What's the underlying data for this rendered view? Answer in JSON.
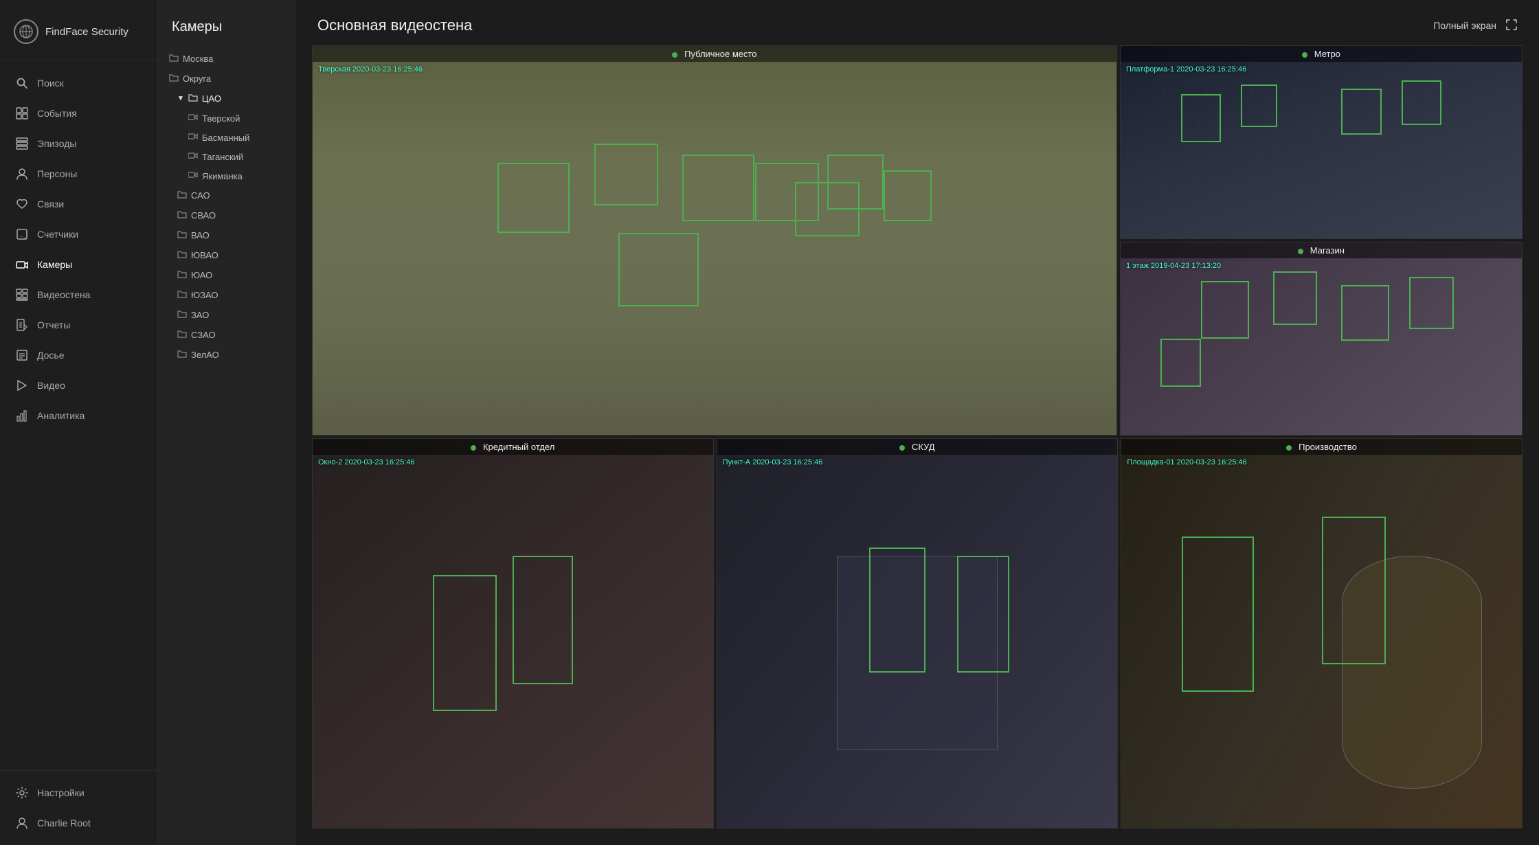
{
  "app": {
    "name": "FindFace Security"
  },
  "sidebar": {
    "items": [
      {
        "id": "search",
        "label": "Поиск",
        "icon": "🔍"
      },
      {
        "id": "events",
        "label": "События",
        "icon": "⊞"
      },
      {
        "id": "episodes",
        "label": "Эпизоды",
        "icon": "⊟"
      },
      {
        "id": "persons",
        "label": "Персоны",
        "icon": "😷"
      },
      {
        "id": "relations",
        "label": "Связи",
        "icon": "♥"
      },
      {
        "id": "counters",
        "label": "Счетчики",
        "icon": "⊡"
      },
      {
        "id": "cameras",
        "label": "Камеры",
        "icon": "📷"
      },
      {
        "id": "videowall",
        "label": "Видеостена",
        "icon": "⊞"
      },
      {
        "id": "reports",
        "label": "Отчеты",
        "icon": "📊"
      },
      {
        "id": "dossier",
        "label": "Досье",
        "icon": "⊟"
      },
      {
        "id": "video",
        "label": "Видео",
        "icon": "🎬"
      },
      {
        "id": "analytics",
        "label": "Аналитика",
        "icon": "📈"
      }
    ],
    "footer": [
      {
        "id": "settings",
        "label": "Настройки",
        "icon": "⚙"
      },
      {
        "id": "user",
        "label": "Charlie Root",
        "icon": "👤"
      }
    ]
  },
  "cameraTree": {
    "title": "Камеры",
    "items": [
      {
        "id": "moskva",
        "level": 1,
        "icon": "folder",
        "label": "Москва"
      },
      {
        "id": "okruga",
        "level": 1,
        "icon": "folder",
        "label": "Округа"
      },
      {
        "id": "cao",
        "level": 2,
        "icon": "folder-open",
        "label": "ЦАО",
        "expanded": true
      },
      {
        "id": "tverskoy",
        "level": 3,
        "icon": "camera",
        "label": "Тверской"
      },
      {
        "id": "basmanny",
        "level": 3,
        "icon": "camera",
        "label": "Басманный"
      },
      {
        "id": "tagansky",
        "level": 3,
        "icon": "camera",
        "label": "Таганский"
      },
      {
        "id": "yakimanka",
        "level": 3,
        "icon": "camera",
        "label": "Якиманка"
      },
      {
        "id": "sao",
        "level": 2,
        "icon": "folder",
        "label": "САО"
      },
      {
        "id": "svao",
        "level": 2,
        "icon": "folder",
        "label": "СВАО"
      },
      {
        "id": "vao",
        "level": 2,
        "icon": "folder",
        "label": "ВАО"
      },
      {
        "id": "uvao",
        "level": 2,
        "icon": "folder",
        "label": "ЮВАО"
      },
      {
        "id": "uao",
        "level": 2,
        "icon": "folder",
        "label": "ЮАО"
      },
      {
        "id": "uzao",
        "level": 2,
        "icon": "folder",
        "label": "ЮЗАО"
      },
      {
        "id": "zao",
        "level": 2,
        "icon": "folder",
        "label": "ЗАО"
      },
      {
        "id": "szao",
        "level": 2,
        "icon": "folder",
        "label": "СЗАО"
      },
      {
        "id": "zelao",
        "level": 2,
        "icon": "folder",
        "label": "ЗелАО"
      }
    ]
  },
  "videowall": {
    "title": "Основная видеостена",
    "fullscreen_label": "Полный экран",
    "cells": [
      {
        "id": "public",
        "label": "Публичное место",
        "camera": "Тверская",
        "timestamp": "2020-03-23  16:25:46",
        "bg": "street",
        "span": "large"
      },
      {
        "id": "metro",
        "label": "Метро",
        "camera": "Платформа-1",
        "timestamp": "2020-03-23  16:25:46",
        "bg": "metro",
        "span": "small"
      },
      {
        "id": "shop",
        "label": "Магазин",
        "camera": "1 этаж",
        "timestamp": "2019-04-23  17:13:20",
        "bg": "shop",
        "span": "small"
      },
      {
        "id": "credit",
        "label": "Кредитный отдел",
        "camera": "Окно-2",
        "timestamp": "2020-03-23  16:25:46",
        "bg": "credit",
        "span": "bottom"
      },
      {
        "id": "access",
        "label": "СКУД",
        "camera": "Пункт-А",
        "timestamp": "2020-03-23  16:25:46",
        "bg": "access",
        "span": "bottom"
      },
      {
        "id": "production",
        "label": "Производство",
        "camera": "Площадка-01",
        "timestamp": "2020-03-23  16:25:46",
        "bg": "production",
        "span": "bottom"
      }
    ]
  }
}
